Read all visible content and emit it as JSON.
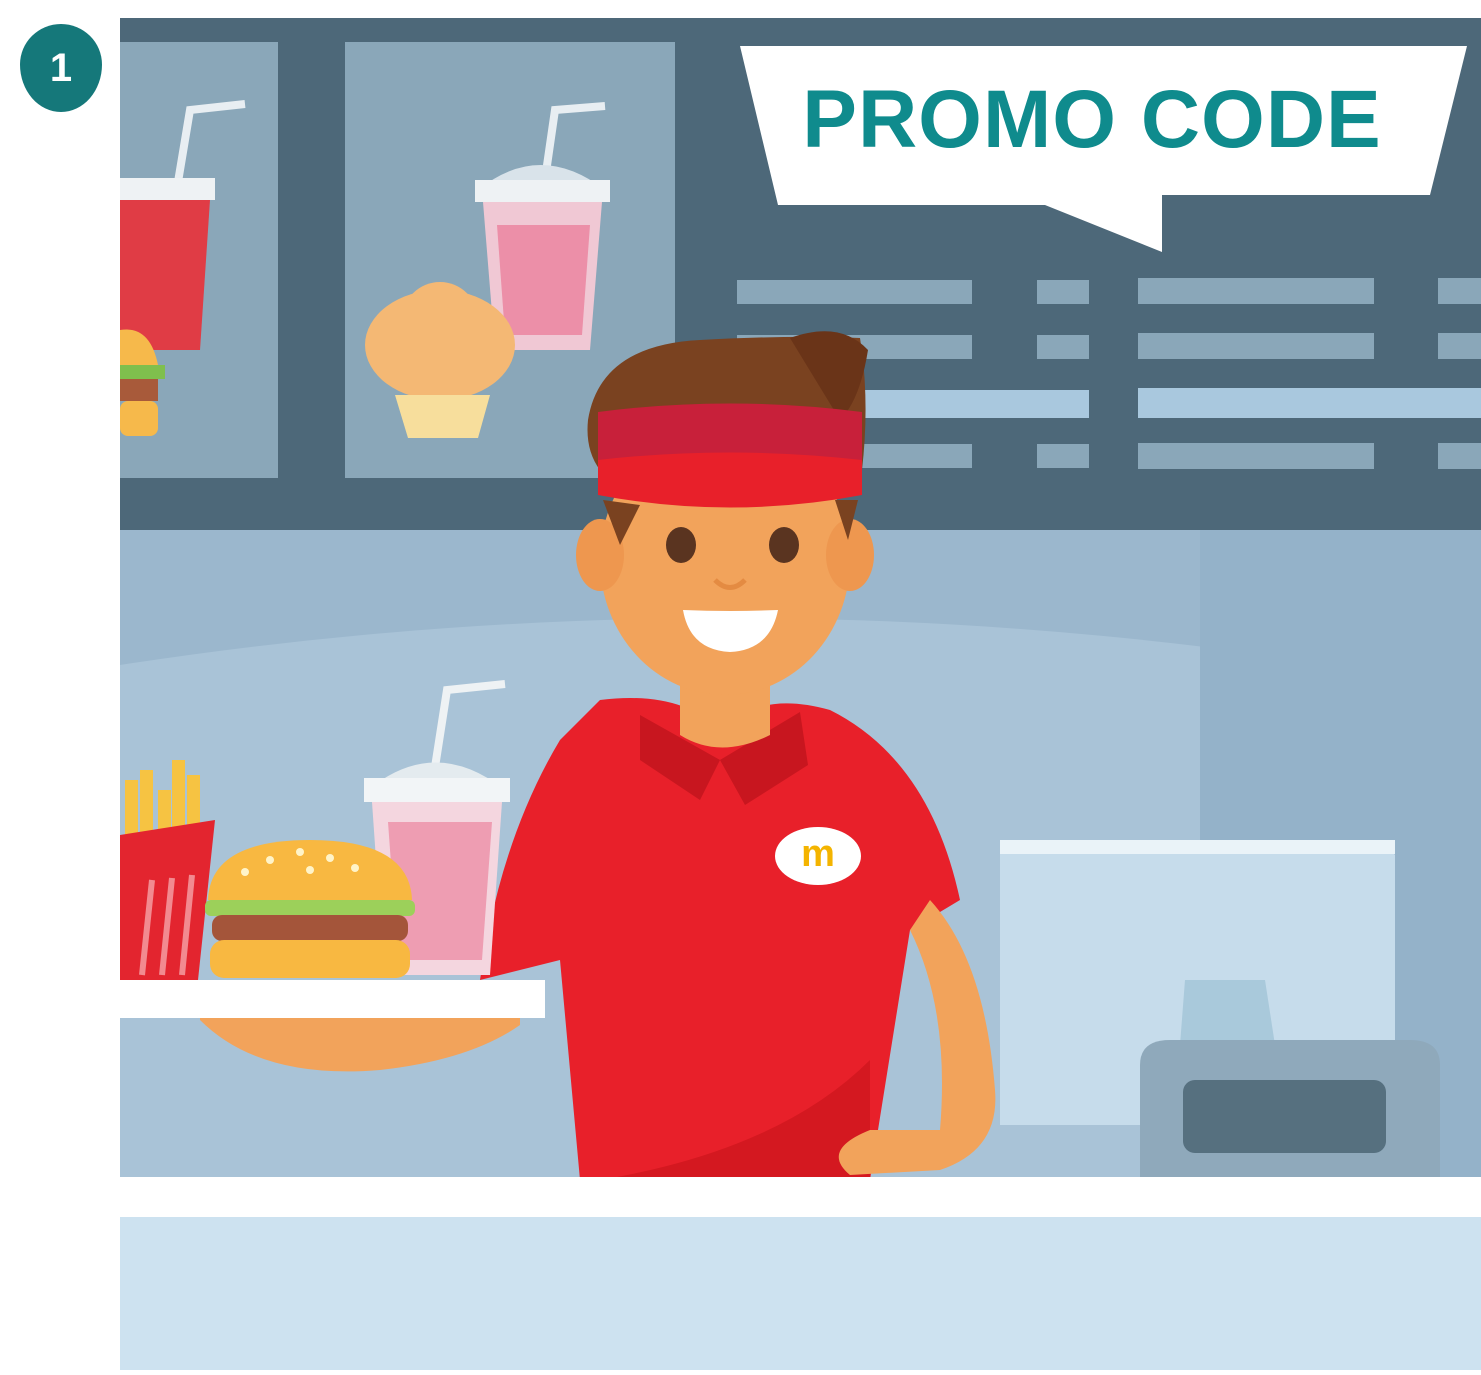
{
  "step": {
    "number": "1"
  },
  "promo": {
    "text": "PROMO CODE"
  },
  "logo": {
    "text": "m"
  },
  "colors": {
    "teal": "#15787a",
    "promo_text": "#0f8b8d",
    "menu_board": "#4e6a7c",
    "wall": "#8aa9c0",
    "uniform_red": "#e8202a",
    "visor_red": "#c8203a"
  },
  "icons": [
    "step-number-badge",
    "speech-bubble",
    "drink-cup-icon",
    "muffin-icon",
    "burger-icon",
    "fries-icon",
    "cash-register-monitor",
    "receipt-printer"
  ]
}
